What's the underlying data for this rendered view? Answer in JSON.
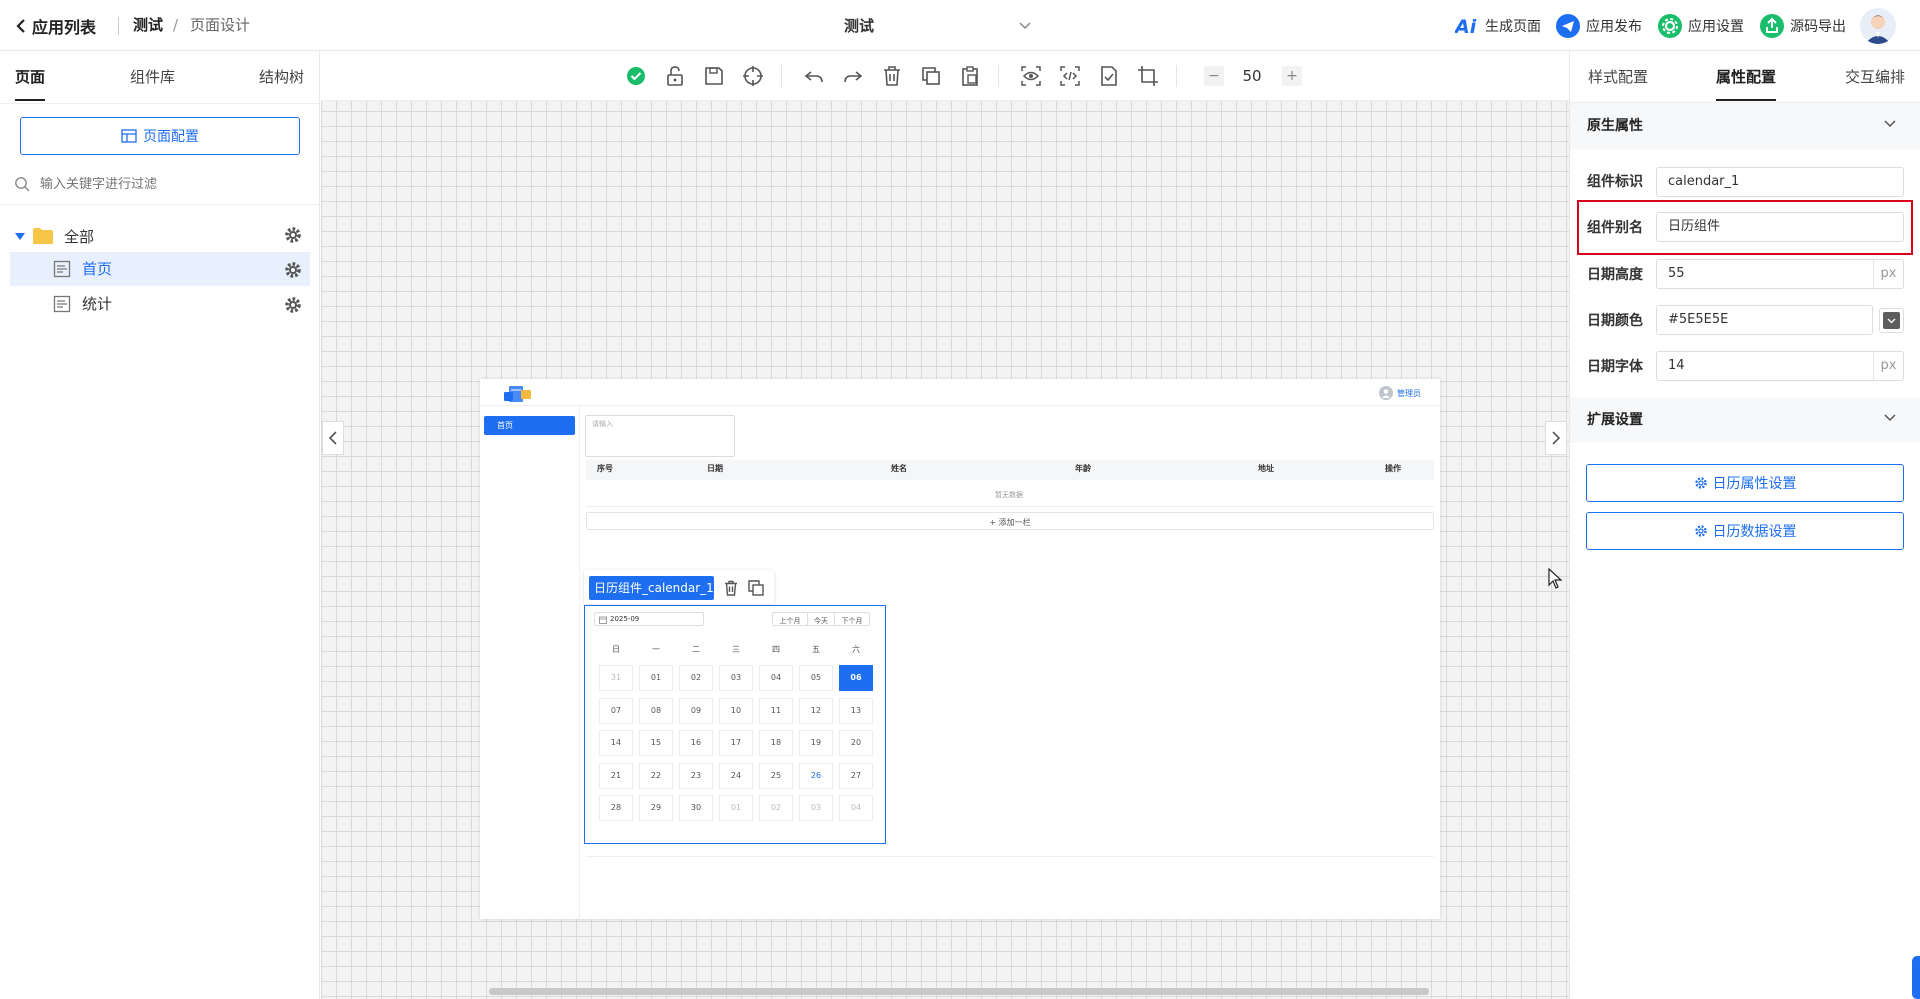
{
  "topbar": {
    "back_label": "应用列表",
    "breadcrumb_app": "测试",
    "breadcrumb_sep": "/",
    "breadcrumb_page": "页面设计",
    "center_title": "测试",
    "actions": [
      {
        "label": "生成页面",
        "icon": "ai-icon"
      },
      {
        "label": "应用发布",
        "icon": "send-icon"
      },
      {
        "label": "应用设置",
        "icon": "settings-icon"
      },
      {
        "label": "源码导出",
        "icon": "export-icon"
      }
    ]
  },
  "left": {
    "tabs": [
      "页面",
      "组件库",
      "结构树"
    ],
    "page_config_button": "页面配置",
    "filter_placeholder": "输入关键字进行过滤",
    "tree": {
      "root": "全部",
      "items": [
        "首页",
        "统计"
      ]
    }
  },
  "toolbar": {
    "zoom_minus": "−",
    "zoom_value": "50",
    "zoom_plus": "+"
  },
  "preview": {
    "header_user": "管理员",
    "menu_item": "首页",
    "input_placeholder": "请输入",
    "table_headers": [
      "序号",
      "日期",
      "姓名",
      "年龄",
      "地址",
      "操作"
    ],
    "table_empty": "暂无数据",
    "add_row": "+ 添加一栏",
    "component_tag": "日历组件_calendar_1",
    "calendar": {
      "month": "2025-09",
      "prev_month": "上个月",
      "today": "今天",
      "next_month": "下个月",
      "weekdays": [
        "日",
        "一",
        "二",
        "三",
        "四",
        "五",
        "六"
      ],
      "days": [
        [
          "31",
          "01",
          "02",
          "03",
          "04",
          "05",
          "06"
        ],
        [
          "07",
          "08",
          "09",
          "10",
          "11",
          "12",
          "13"
        ],
        [
          "14",
          "15",
          "16",
          "17",
          "18",
          "19",
          "20"
        ],
        [
          "21",
          "22",
          "23",
          "24",
          "25",
          "26",
          "27"
        ],
        [
          "28",
          "29",
          "30",
          "01",
          "02",
          "03",
          "04"
        ]
      ],
      "selected": "06",
      "today_day": "26"
    }
  },
  "right": {
    "tabs": [
      "样式配置",
      "属性配置",
      "交互编排"
    ],
    "section_native": "原生属性",
    "fields": [
      {
        "label": "组件标识",
        "value": "calendar_1"
      },
      {
        "label": "组件别名",
        "value": "日历组件"
      },
      {
        "label": "日期高度",
        "value": "55",
        "unit": "px"
      },
      {
        "label": "日期颜色",
        "value": "#5E5E5E"
      },
      {
        "label": "日期字体",
        "value": "14",
        "unit": "px"
      }
    ],
    "section_ext": "扩展设置",
    "btn_calendar_props": "日历属性设置",
    "btn_calendar_data": "日历数据设置"
  },
  "colors": {
    "accent": "#1e6ef2",
    "highlight_red": "#d9001b",
    "green": "#19be6b"
  }
}
